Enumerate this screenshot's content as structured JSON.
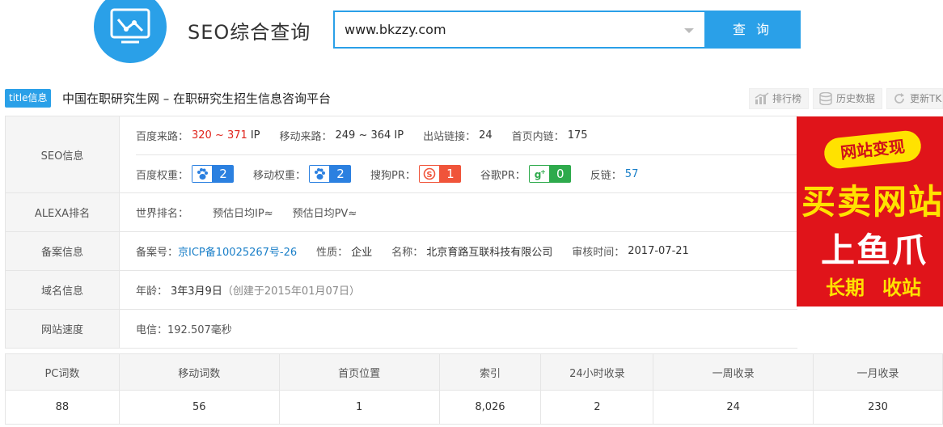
{
  "header": {
    "logo_icon": "chart-monitor-icon",
    "title": "SEO综合查询",
    "search_value": "www.bkzzy.com",
    "search_button": "查 询",
    "accent": "#2aa0e8"
  },
  "title_line": {
    "tag": "title信息",
    "text": "中国在职研究生网 – 在职研究生招生信息咨询平台",
    "tools": [
      "排行榜",
      "历史数据",
      "更新TK"
    ]
  },
  "seo": {
    "label": "SEO信息",
    "baidu_source_label": "百度来路：",
    "baidu_source_value": "320 ~ 371",
    "baidu_source_unit": "IP",
    "mobile_source_label": "移动来路：",
    "mobile_source_value": "249 ~ 364 IP",
    "outbound_label": "出站链接：",
    "outbound_value": "24",
    "internal_label": "首页内链：",
    "internal_value": "175",
    "baidu_weight_label": "百度权重：",
    "baidu_weight": "2",
    "mobile_weight_label": "移动权重：",
    "mobile_weight": "2",
    "sogou_label": "搜狗PR：",
    "sogou_value": "1",
    "google_label": "谷歌PR：",
    "google_value": "0",
    "backlink_label": "反链：",
    "backlink_value": "57"
  },
  "alexa": {
    "label": "ALEXA排名",
    "world_rank": "世界排名：",
    "est_ip": "预估日均IP≈",
    "est_pv": "预估日均PV≈"
  },
  "icp": {
    "label": "备案信息",
    "number_label": "备案号：",
    "number_value": "京ICP备10025267号-26",
    "nature_label": "性质：",
    "nature_value": "企业",
    "name_label": "名称：",
    "name_value": "北京育路互联科技有限公司",
    "audit_label": "审核时间：",
    "audit_value": "2017-07-21"
  },
  "domain": {
    "label": "域名信息",
    "age_label": "年龄：",
    "age_value": "3年3月9日",
    "created": "（创建于2015年01月07日）"
  },
  "speed": {
    "label": "网站速度",
    "value": "电信：192.507毫秒"
  },
  "ad": {
    "banner": "网站变现",
    "line1": "买卖网站",
    "line2": "上鱼爪",
    "line3a": "长期",
    "line3b": "收站"
  },
  "stats": {
    "headers": [
      "PC词数",
      "移动词数",
      "首页位置",
      "索引",
      "24小时收录",
      "一周收录",
      "一月收录"
    ],
    "values": [
      "88",
      "56",
      "1",
      "8,026",
      "2",
      "24",
      "230"
    ]
  }
}
